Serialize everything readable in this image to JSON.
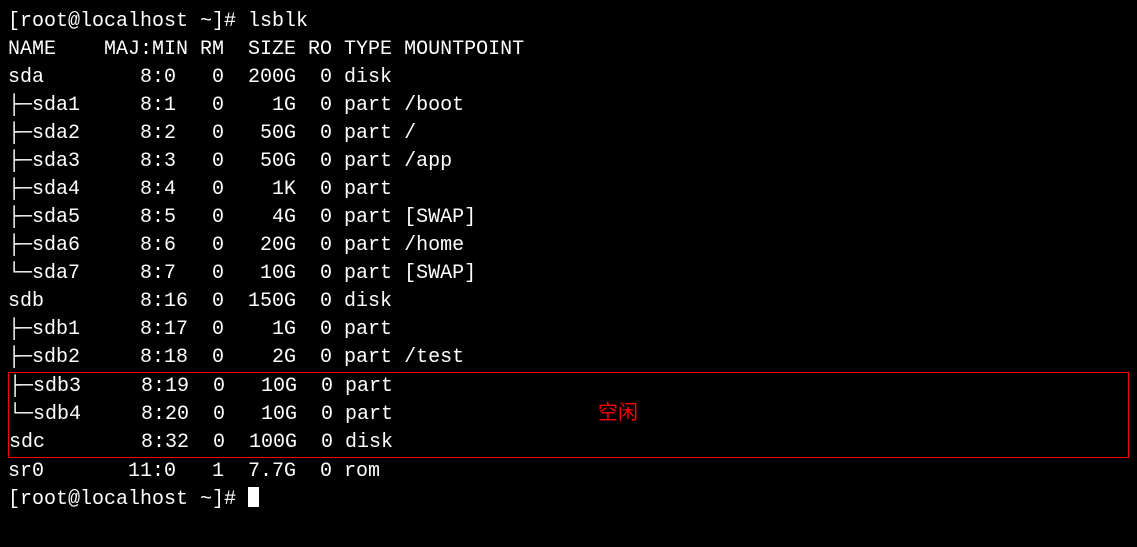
{
  "prompt1": "[root@localhost ~]# lsblk",
  "prompt2": "[root@localhost ~]# ",
  "headers": {
    "name": "NAME",
    "majmin": "MAJ:MIN",
    "rm": "RM",
    "size": "SIZE",
    "ro": "RO",
    "type": "TYPE",
    "mountpoint": "MOUNTPOINT"
  },
  "rows": [
    {
      "name": "sda",
      "tree": "",
      "maj": " 8:0 ",
      "rm": "0",
      "size": " 200G",
      "ro": "0",
      "type": "disk",
      "mount": ""
    },
    {
      "name": "├─sda1",
      "tree": "t",
      "maj": " 8:1 ",
      "rm": "0",
      "size": "   1G",
      "ro": "0",
      "type": "part",
      "mount": "/boot"
    },
    {
      "name": "├─sda2",
      "tree": "t",
      "maj": " 8:2 ",
      "rm": "0",
      "size": "  50G",
      "ro": "0",
      "type": "part",
      "mount": "/"
    },
    {
      "name": "├─sda3",
      "tree": "t",
      "maj": " 8:3 ",
      "rm": "0",
      "size": "  50G",
      "ro": "0",
      "type": "part",
      "mount": "/app"
    },
    {
      "name": "├─sda4",
      "tree": "t",
      "maj": " 8:4 ",
      "rm": "0",
      "size": "   1K",
      "ro": "0",
      "type": "part",
      "mount": ""
    },
    {
      "name": "├─sda5",
      "tree": "t",
      "maj": " 8:5 ",
      "rm": "0",
      "size": "   4G",
      "ro": "0",
      "type": "part",
      "mount": "[SWAP]"
    },
    {
      "name": "├─sda6",
      "tree": "t",
      "maj": " 8:6 ",
      "rm": "0",
      "size": "  20G",
      "ro": "0",
      "type": "part",
      "mount": "/home"
    },
    {
      "name": "└─sda7",
      "tree": "l",
      "maj": " 8:7 ",
      "rm": "0",
      "size": "  10G",
      "ro": "0",
      "type": "part",
      "mount": "[SWAP]"
    },
    {
      "name": "sdb",
      "tree": "",
      "maj": " 8:16",
      "rm": "0",
      "size": " 150G",
      "ro": "0",
      "type": "disk",
      "mount": ""
    },
    {
      "name": "├─sdb1",
      "tree": "t",
      "maj": " 8:17",
      "rm": "0",
      "size": "   1G",
      "ro": "0",
      "type": "part",
      "mount": ""
    },
    {
      "name": "├─sdb2",
      "tree": "t",
      "maj": " 8:18",
      "rm": "0",
      "size": "   2G",
      "ro": "0",
      "type": "part",
      "mount": "/test"
    }
  ],
  "highlight_rows": [
    {
      "name": "├─sdb3",
      "tree": "t",
      "maj": " 8:19",
      "rm": "0",
      "size": "  10G",
      "ro": "0",
      "type": "part",
      "mount": ""
    },
    {
      "name": "└─sdb4",
      "tree": "l",
      "maj": " 8:20",
      "rm": "0",
      "size": "  10G",
      "ro": "0",
      "type": "part",
      "mount": ""
    },
    {
      "name": "sdc",
      "tree": "",
      "maj": " 8:32",
      "rm": "0",
      "size": " 100G",
      "ro": "0",
      "type": "disk",
      "mount": ""
    }
  ],
  "after_rows": [
    {
      "name": "sr0",
      "tree": "",
      "maj": "11:0 ",
      "rm": "1",
      "size": " 7.7G",
      "ro": "0",
      "type": "rom ",
      "mount": ""
    }
  ],
  "annotation": "空闲",
  "chart_data": {
    "type": "table",
    "title": "lsblk output",
    "columns": [
      "NAME",
      "MAJ:MIN",
      "RM",
      "SIZE",
      "RO",
      "TYPE",
      "MOUNTPOINT"
    ],
    "rows": [
      [
        "sda",
        "8:0",
        0,
        "200G",
        0,
        "disk",
        ""
      ],
      [
        "sda1",
        "8:1",
        0,
        "1G",
        0,
        "part",
        "/boot"
      ],
      [
        "sda2",
        "8:2",
        0,
        "50G",
        0,
        "part",
        "/"
      ],
      [
        "sda3",
        "8:3",
        0,
        "50G",
        0,
        "part",
        "/app"
      ],
      [
        "sda4",
        "8:4",
        0,
        "1K",
        0,
        "part",
        ""
      ],
      [
        "sda5",
        "8:5",
        0,
        "4G",
        0,
        "part",
        "[SWAP]"
      ],
      [
        "sda6",
        "8:6",
        0,
        "20G",
        0,
        "part",
        "/home"
      ],
      [
        "sda7",
        "8:7",
        0,
        "10G",
        0,
        "part",
        "[SWAP]"
      ],
      [
        "sdb",
        "8:16",
        0,
        "150G",
        0,
        "disk",
        ""
      ],
      [
        "sdb1",
        "8:17",
        0,
        "1G",
        0,
        "part",
        ""
      ],
      [
        "sdb2",
        "8:18",
        0,
        "2G",
        0,
        "part",
        "/test"
      ],
      [
        "sdb3",
        "8:19",
        0,
        "10G",
        0,
        "part",
        ""
      ],
      [
        "sdb4",
        "8:20",
        0,
        "10G",
        0,
        "part",
        ""
      ],
      [
        "sdc",
        "8:32",
        0,
        "100G",
        0,
        "disk",
        ""
      ],
      [
        "sr0",
        "11:0",
        1,
        "7.7G",
        0,
        "rom",
        ""
      ]
    ]
  }
}
